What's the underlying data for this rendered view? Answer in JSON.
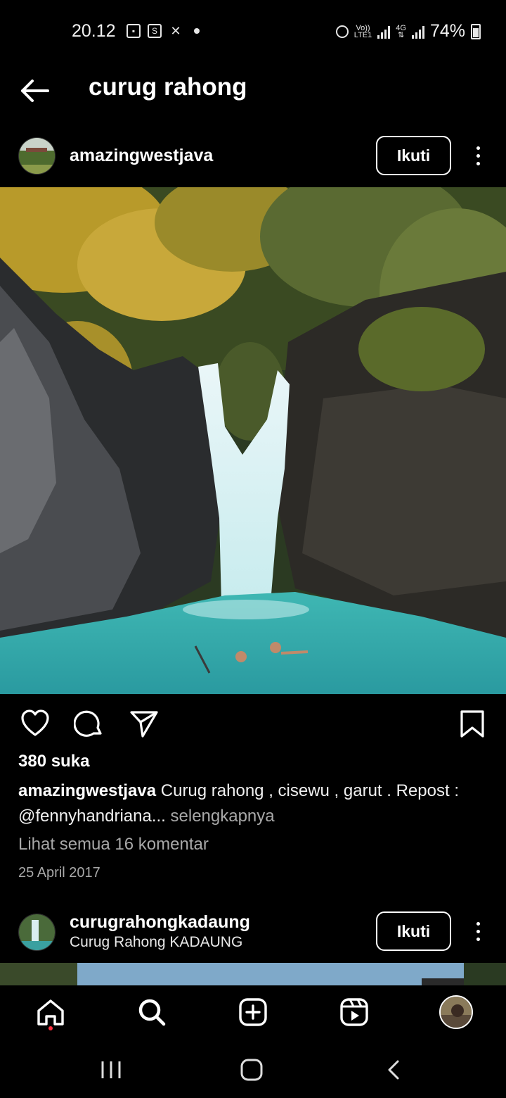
{
  "status_bar": {
    "time": "20.12",
    "network_top": "Vo))",
    "network_bottom": "LTE1",
    "net2_top": "4G",
    "net2_bottom": "⇅",
    "battery": "74%"
  },
  "header": {
    "title": "curug rahong"
  },
  "posts": [
    {
      "username": "amazingwestjava",
      "follow_label": "Ikuti",
      "likes": "380 suka",
      "caption_user": "amazingwestjava",
      "caption_text": " Curug rahong , cisewu , garut . Repost : @fennyhandriana...",
      "caption_more": " selengkapnya",
      "comments_link": "Lihat semua 16 komentar",
      "date": "25 April 2017"
    },
    {
      "username": "curugrahongkadaung",
      "subline": "Curug Rahong KADAUNG",
      "follow_label": "Ikuti"
    }
  ],
  "icons": {
    "back": "arrow-left-icon",
    "like": "heart-icon",
    "comment": "comment-bubble-icon",
    "share": "paper-plane-icon",
    "save": "bookmark-icon",
    "home": "home-icon",
    "search": "search-icon",
    "create": "plus-square-icon",
    "reels": "reels-icon"
  },
  "colors": {
    "background": "#000000",
    "text": "#ffffff",
    "muted": "#a8a8a8",
    "notification_dot": "#ff3040"
  }
}
